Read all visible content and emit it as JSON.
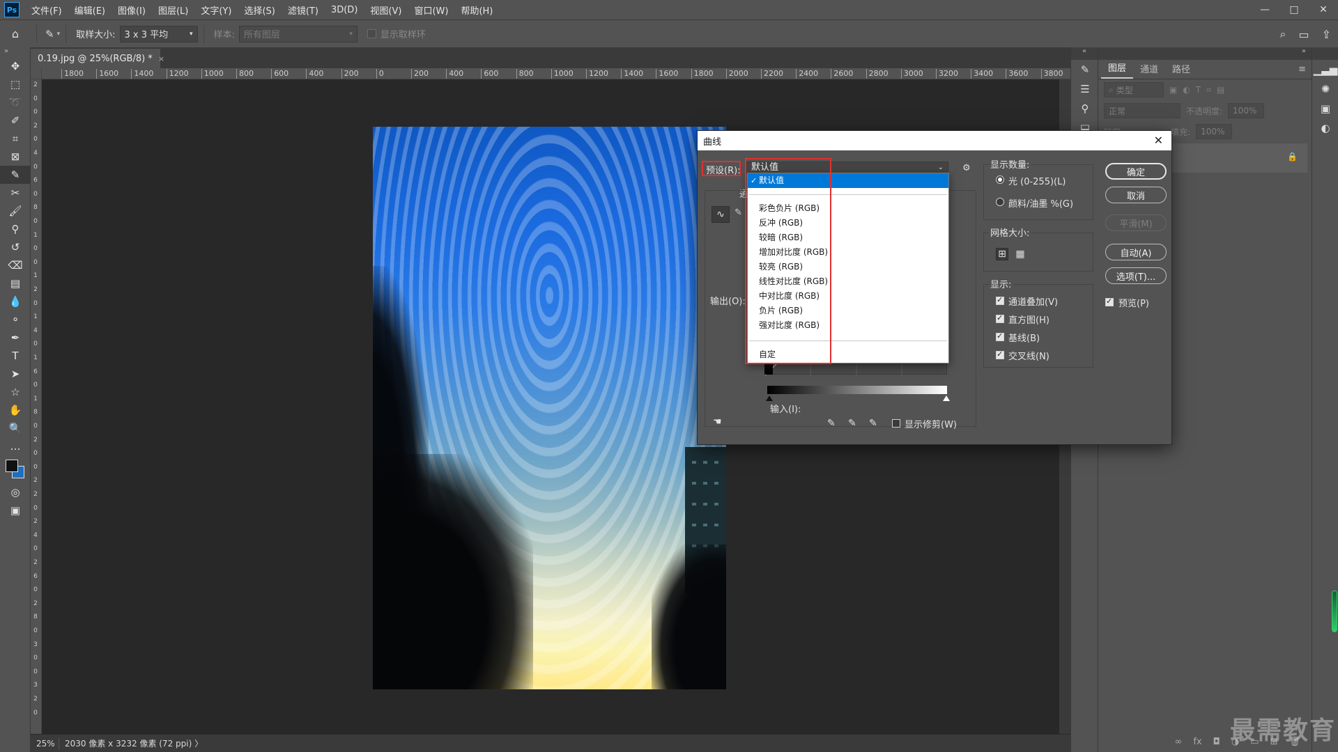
{
  "menubar": {
    "items": [
      "文件(F)",
      "编辑(E)",
      "图像(I)",
      "图层(L)",
      "文字(Y)",
      "选择(S)",
      "滤镜(T)",
      "3D(D)",
      "视图(V)",
      "窗口(W)",
      "帮助(H)"
    ],
    "logo": "Ps",
    "window_controls": [
      "—",
      "□",
      "✕"
    ]
  },
  "options_bar": {
    "sample_size_label": "取样大小:",
    "sample_size_value": "3 x 3 平均",
    "sample_label": "样本:",
    "sample_value": "所有图层",
    "show_ring_label": "显示取样环"
  },
  "document": {
    "tab_title": "0.19.jpg @ 25%(RGB/8) *",
    "tab_close": "×",
    "ruler_top": [
      "1800",
      "1600",
      "1400",
      "1200",
      "1000",
      "800",
      "600",
      "400",
      "200",
      "0",
      "200",
      "400",
      "600",
      "800",
      "1000",
      "1200",
      "1400",
      "1600",
      "1800",
      "2000",
      "2200",
      "2400",
      "2600",
      "2800",
      "3000",
      "3200",
      "3400",
      "3600",
      "3800"
    ],
    "ruler_left": [
      "2",
      "0",
      "0",
      "2",
      "0",
      "4",
      "0",
      "6",
      "0",
      "8",
      "0",
      "1",
      "0",
      "0",
      "1",
      "2",
      "0",
      "1",
      "4",
      "0",
      "1",
      "6",
      "0",
      "1",
      "8",
      "0",
      "2",
      "0",
      "0",
      "2",
      "2",
      "0",
      "2",
      "4",
      "0",
      "2",
      "6",
      "0",
      "2",
      "8",
      "0",
      "3",
      "0",
      "0",
      "3",
      "2",
      "0"
    ]
  },
  "statusbar": {
    "zoom": "25%",
    "info": "2030 像素 x 3232 像素 (72 ppi)",
    "arrow": "〉"
  },
  "layers_panel": {
    "collapse": "»",
    "tabs": [
      "图层",
      "通道",
      "路径"
    ],
    "filter_placeholder": "类型",
    "blend_mode": "正常",
    "opacity_label": "不透明度:",
    "opacity_value": "100%",
    "lock_label": "锁定:",
    "fill_label": "填充:",
    "fill_value": "100%"
  },
  "curves_dialog": {
    "title": "曲线",
    "close": "✕",
    "preset_label": "预设(R):",
    "preset_value": "默认值",
    "channel_label": "通",
    "output_label": "输出(O):",
    "input_label": "输入(I):",
    "show_clipping_label": "显示修剪(W)",
    "show_amount_label": "显示数量:",
    "light_option": "光 (0-255)(L)",
    "pigment_option": "颜料/油墨 %(G)",
    "grid_size_label": "网格大小:",
    "show_label": "显示:",
    "channel_overlay": "通道叠加(V)",
    "histogram": "直方图(H)",
    "baseline": "基线(B)",
    "intersection": "交叉线(N)",
    "buttons": {
      "ok": "确定",
      "cancel": "取消",
      "smooth": "平滑(M)",
      "auto": "自动(A)",
      "options": "选项(T)..."
    },
    "preview_label": "预览(P)"
  },
  "preset_list": {
    "selected": "默认值",
    "check": "✓",
    "items": [
      "彩色负片 (RGB)",
      "反冲 (RGB)",
      "较暗 (RGB)",
      "增加对比度 (RGB)",
      "较亮 (RGB)",
      "线性对比度 (RGB)",
      "中对比度 (RGB)",
      "负片 (RGB)",
      "强对比度 (RGB)"
    ],
    "custom": "自定"
  },
  "watermark": "最需教育",
  "colors": {
    "highlight": "#e03030",
    "selection": "#0078d7",
    "foreground": "#111111",
    "background": "#1f6fbf"
  }
}
